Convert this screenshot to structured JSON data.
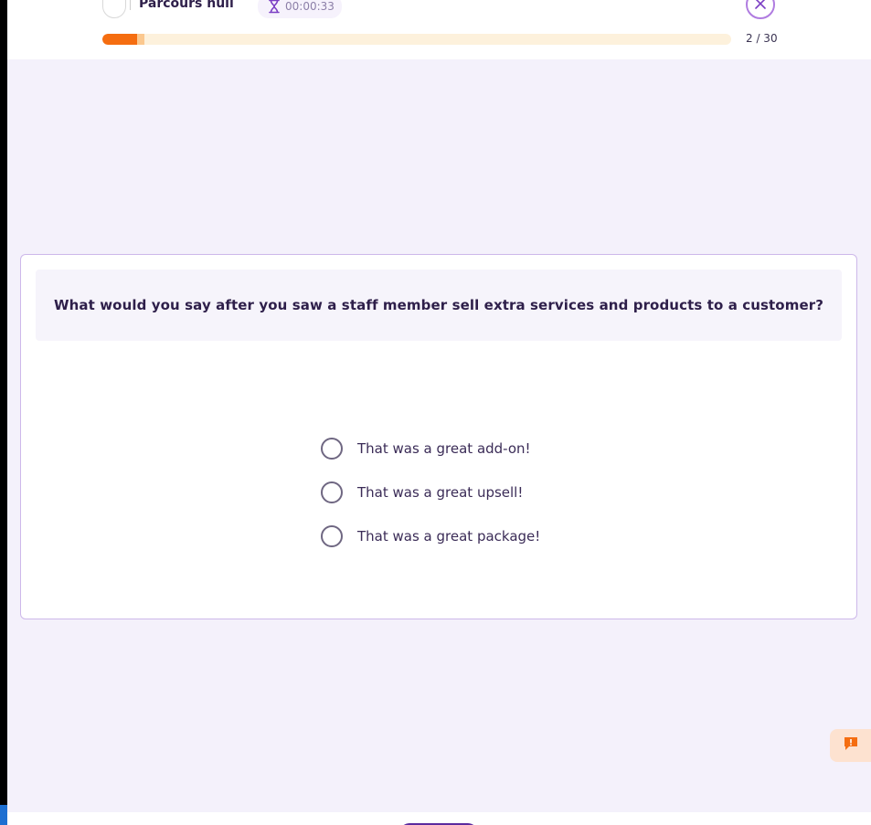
{
  "header": {
    "title": "Parcours null",
    "timer": "00:00:33",
    "progress": {
      "current": 2,
      "total": 30,
      "label": "2 / 30"
    }
  },
  "question": {
    "text": "What would you say after you saw a staff member sell extra services and products to a customer?"
  },
  "options": [
    {
      "label": "That was a great add-on!"
    },
    {
      "label": "That was a great upsell!"
    },
    {
      "label": "That was a great package!"
    }
  ],
  "colors": {
    "accent_orange": "#f56d10",
    "accent_purple": "#b07ce0",
    "background": "#f4f1fb",
    "text_dark": "#2e1f4a"
  },
  "icons": {
    "timer": "hourglass-icon",
    "close": "close-icon",
    "feedback": "alert-message-icon"
  }
}
